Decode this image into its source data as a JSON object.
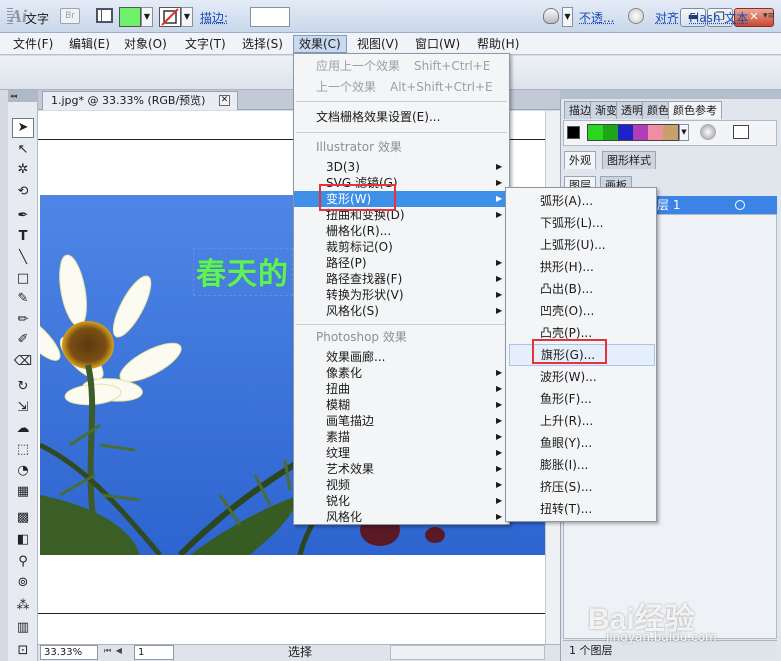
{
  "titlebar": {
    "logo": "Ai",
    "bridge_label": "Br",
    "min_glyph": "▬",
    "max_glyph": "❐",
    "close_glyph": "✕"
  },
  "menubar": {
    "items": [
      "文件(F)",
      "编辑(E)",
      "对象(O)",
      "文字(T)",
      "选择(S)",
      "效果(C)",
      "视图(V)",
      "窗口(W)",
      "帮助(H)"
    ]
  },
  "controlbar": {
    "object_type": "文字",
    "fill_color": "#6ef26c",
    "stroke_label": "描边:",
    "opacity_label": "不透...",
    "align_label": "对齐",
    "flash_text_label": "Flash 文本"
  },
  "document": {
    "tab_title": "1.jpg* @ 33.33% (RGB/预览)",
    "art_text": "春天的"
  },
  "statusbar": {
    "zoom": "33.33%",
    "page": "1",
    "status": "选择"
  },
  "right_panel": {
    "top_tabs": [
      "描边",
      "渐变",
      "透明",
      "颜色",
      "颜色参考"
    ],
    "mid_tabs": [
      "外观",
      "图形样式"
    ],
    "layer_tabs": [
      "图层",
      "画板"
    ],
    "swatch_colors": [
      "#2bd61f",
      "#1ea61a",
      "#1d22c7",
      "#b33cb7",
      "#ef8ea0",
      "#c9a06a"
    ],
    "layer_name": "层 1",
    "layers_count": "1 个图层"
  },
  "effects_menu": {
    "apply_last": {
      "label": "应用上一个效果",
      "shortcut": "Shift+Ctrl+E"
    },
    "last_effect": {
      "label": "上一个效果",
      "shortcut": "Alt+Shift+Ctrl+E"
    },
    "raster_settings": "文档栅格效果设置(E)...",
    "illustrator_header": "Illustrator 效果",
    "illustrator_items": [
      "3D(3)",
      "SVG 滤镜(G)",
      "变形(W)",
      "扭曲和变换(D)",
      "栅格化(R)...",
      "裁剪标记(O)",
      "路径(P)",
      "路径查找器(F)",
      "转换为形状(V)",
      "风格化(S)"
    ],
    "photoshop_header": "Photoshop 效果",
    "photoshop_items": [
      "效果画廊...",
      "像素化",
      "扭曲",
      "模糊",
      "画笔描边",
      "素描",
      "纹理",
      "艺术效果",
      "视频",
      "锐化",
      "风格化"
    ]
  },
  "warp_submenu": {
    "items": [
      "弧形(A)...",
      "下弧形(L)...",
      "上弧形(U)...",
      "拱形(H)...",
      "凸出(B)...",
      "凹壳(O)...",
      "凸壳(P)...",
      "旗形(G)...",
      "波形(W)...",
      "鱼形(F)...",
      "上升(R)...",
      "鱼眼(Y)...",
      "膨胀(I)...",
      "挤压(S)...",
      "扭转(T)..."
    ]
  },
  "watermark": {
    "logo": "Bai经验",
    "sub": "jingyan.baidu.com"
  }
}
